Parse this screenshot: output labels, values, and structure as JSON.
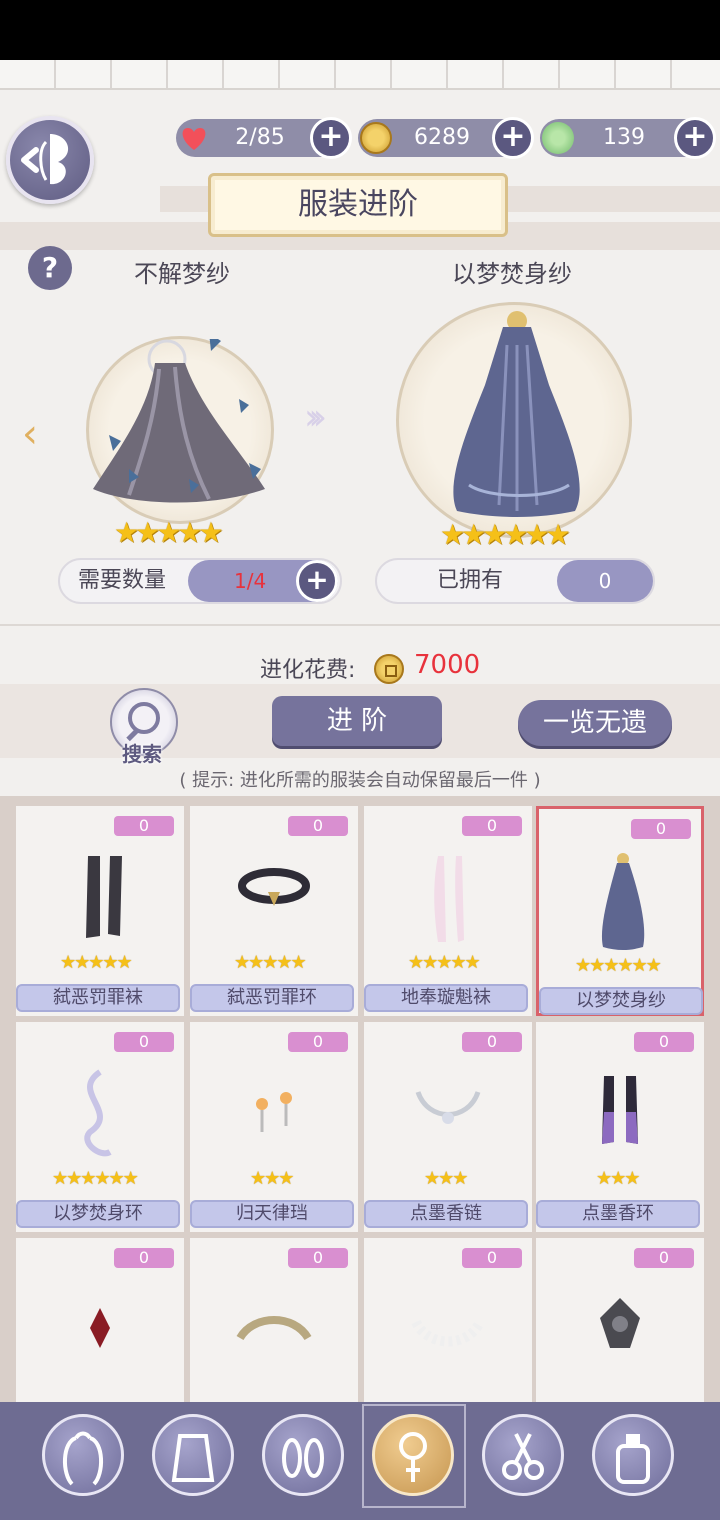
{
  "header": {
    "title": "服装进阶",
    "resources": [
      {
        "name": "stamina",
        "icon": "heart-icon",
        "value": "2/85"
      },
      {
        "name": "coins",
        "icon": "coin-icon",
        "value": "6289"
      },
      {
        "name": "gems",
        "icon": "jade-icon",
        "value": "139"
      }
    ]
  },
  "evolve": {
    "source_name": "不解梦纱",
    "target_name": "以梦焚身纱",
    "source_stars": "★★★★★",
    "target_stars": "★★★★★★",
    "need_label": "需要数量",
    "need_value": "1/4",
    "owned_label": "已拥有",
    "owned_value": "0",
    "cost_label": "进化花费:",
    "cost_value": "7000"
  },
  "actions": {
    "search_label": "搜索",
    "evolve_label": "进 阶",
    "overview_label": "一览无遗",
    "hint": "( 提示: 进化所需的服装会自动保留最后一件 )"
  },
  "items": [
    {
      "name": "弑恶罚罪袜",
      "count": "0",
      "stars": "★★★★★"
    },
    {
      "name": "弑恶罚罪环",
      "count": "0",
      "stars": "★★★★★"
    },
    {
      "name": "地奉璇魁袜",
      "count": "0",
      "stars": "★★★★★"
    },
    {
      "name": "以梦焚身纱",
      "count": "0",
      "stars": "★★★★★★",
      "selected": true
    },
    {
      "name": "以梦焚身环",
      "count": "0",
      "stars": "★★★★★★"
    },
    {
      "name": "归天律珰",
      "count": "0",
      "stars": "★★★"
    },
    {
      "name": "点墨香链",
      "count": "0",
      "stars": "★★★"
    },
    {
      "name": "点墨香环",
      "count": "0",
      "stars": "★★★"
    },
    {
      "name": "",
      "count": "0",
      "stars": "★★★★"
    },
    {
      "name": "",
      "count": "0",
      "stars": "★★★★"
    },
    {
      "name": "",
      "count": "0",
      "stars": "★★★★"
    },
    {
      "name": "",
      "count": "0",
      "stars": "★★★★"
    }
  ],
  "nav": [
    {
      "icon": "hair-icon"
    },
    {
      "icon": "dress-icon"
    },
    {
      "icon": "shoes-icon"
    },
    {
      "icon": "accessory-icon",
      "active": true
    },
    {
      "icon": "scissors-icon"
    },
    {
      "icon": "cosmetics-icon"
    }
  ]
}
